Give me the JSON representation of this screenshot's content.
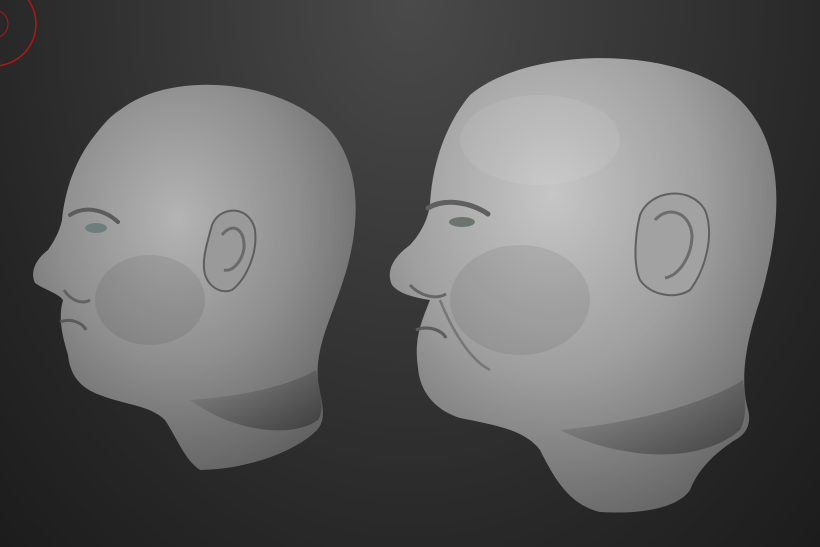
{
  "viewport": {
    "background_top": "#4a4a4a",
    "background_bottom": "#1c1c1c",
    "material_color": "#9a9a9a"
  },
  "cursor_indicator": {
    "icon": "brush-ring-icon",
    "color": "#b01818"
  },
  "models": [
    {
      "name": "head-model-base",
      "subdivision": "low-detail"
    },
    {
      "name": "head-model-detailed",
      "subdivision": "high-detail"
    }
  ]
}
